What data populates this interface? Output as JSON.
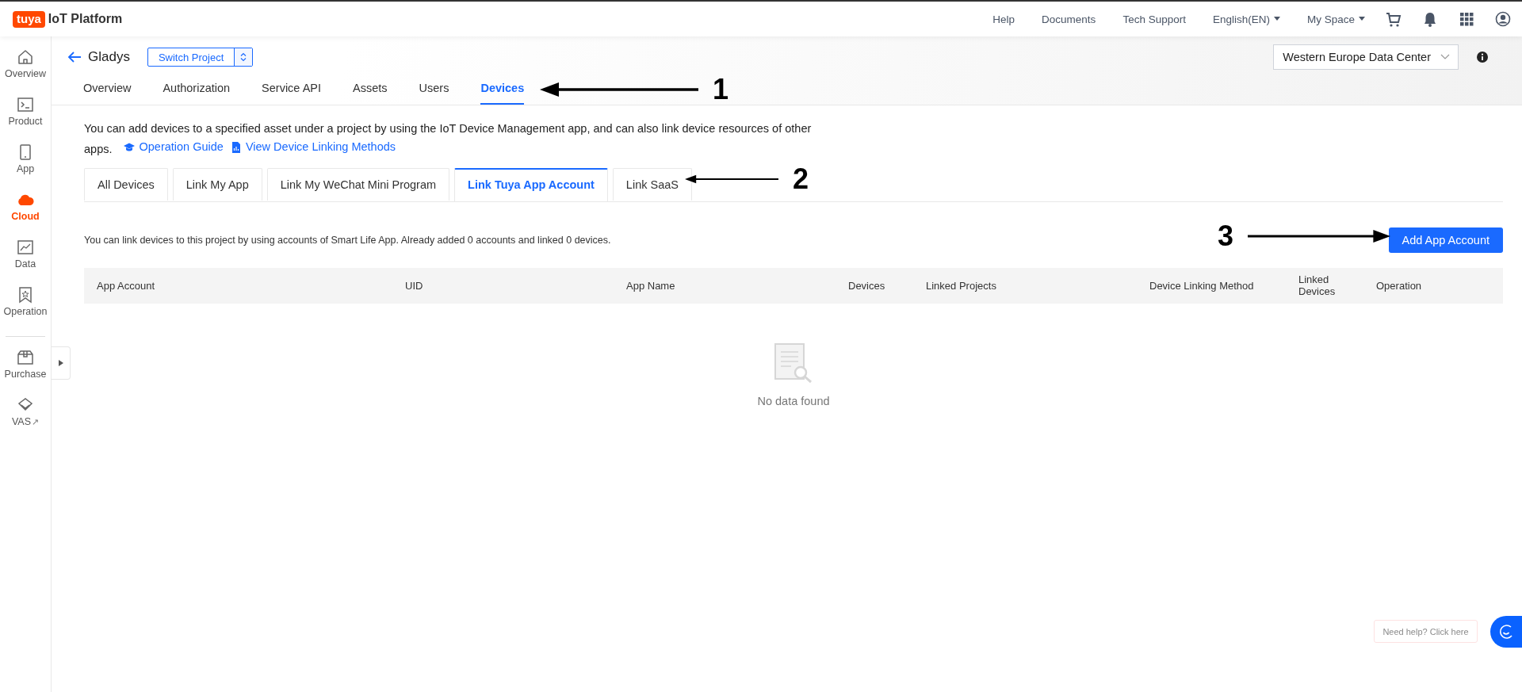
{
  "header": {
    "logo": "tuya",
    "title": "IoT Platform",
    "links": [
      {
        "label": "Help",
        "kind": "link"
      },
      {
        "label": "Documents",
        "kind": "link"
      },
      {
        "label": "Tech Support",
        "kind": "link"
      },
      {
        "label": "English(EN)",
        "kind": "dropdown"
      },
      {
        "label": "My Space",
        "kind": "dropdown"
      }
    ]
  },
  "sidebar": {
    "items": [
      {
        "label": "Overview",
        "selected": false
      },
      {
        "label": "Product",
        "selected": false
      },
      {
        "label": "App",
        "selected": false
      },
      {
        "label": "Cloud",
        "selected": true
      },
      {
        "label": "Data",
        "selected": false
      },
      {
        "label": "Operation",
        "selected": false
      }
    ],
    "bottom_items": [
      {
        "label": "Purchase",
        "selected": false
      },
      {
        "label": "VAS",
        "selected": false,
        "external": "↗"
      }
    ]
  },
  "project": {
    "name": "Gladys",
    "switch_button": "Switch Project",
    "data_center": "Western Europe Data Center"
  },
  "nav_tabs": [
    {
      "label": "Overview",
      "selected": false
    },
    {
      "label": "Authorization",
      "selected": false
    },
    {
      "label": "Service API",
      "selected": false
    },
    {
      "label": "Assets",
      "selected": false
    },
    {
      "label": "Users",
      "selected": false
    },
    {
      "label": "Devices",
      "selected": true
    }
  ],
  "description": {
    "text": "You can add devices to a specified asset under a project by using the IoT Device Management app, and can also link device resources of other apps.",
    "links": [
      {
        "label": "Operation Guide"
      },
      {
        "label": "View Device Linking Methods"
      }
    ]
  },
  "sub_tabs": [
    {
      "label": "All Devices",
      "selected": false
    },
    {
      "label": "Link My App",
      "selected": false
    },
    {
      "label": "Link My WeChat Mini Program",
      "selected": false
    },
    {
      "label": "Link Tuya App Account",
      "selected": true
    },
    {
      "label": "Link SaaS",
      "selected": false
    }
  ],
  "info_text": "You can link devices to this project by using accounts of Smart Life App. Already added 0 accounts and linked 0 devices.",
  "add_button": "Add App Account",
  "table": {
    "columns": [
      "App Account",
      "UID",
      "App Name",
      "Devices",
      "Linked Projects",
      "Device Linking Method",
      "Linked Devices",
      "Operation"
    ],
    "empty_text": "No data found"
  },
  "help": {
    "text": "Need help? Click here"
  },
  "annotations": [
    {
      "number": "1"
    },
    {
      "number": "2"
    },
    {
      "number": "3"
    }
  ]
}
